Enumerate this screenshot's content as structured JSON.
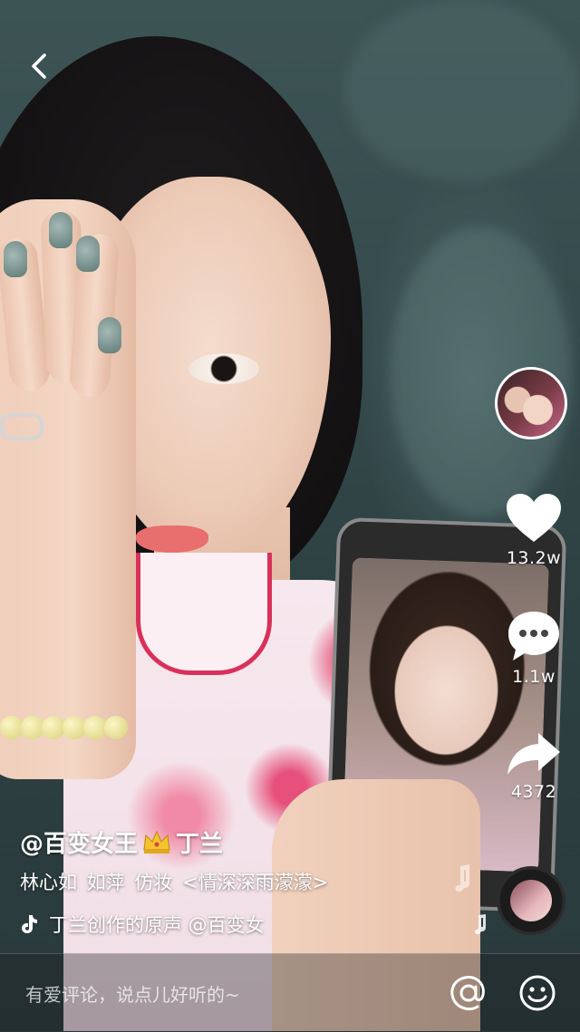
{
  "video": {
    "author_handle": "@百变女王",
    "author_handle_suffix": "丁兰",
    "description": "林心如 如萍 仿妆 <情深深雨濛濛>",
    "music_text": "丁兰创作的原声    @百变女"
  },
  "actions": {
    "likes": "13.2w",
    "comments": "1.1w",
    "shares": "4372"
  },
  "comment_bar": {
    "placeholder": "有爱评论，说点儿好听的~"
  },
  "icons": {
    "back": "chevron-left-icon",
    "like": "heart-icon",
    "comment": "speech-bubble-icon",
    "share": "share-arrow-icon",
    "crown": "crown-icon",
    "music": "tiktok-note-icon",
    "mention": "at-sign-icon",
    "emoji": "smiley-icon"
  },
  "colors": {
    "overlay_text": "#ffffff",
    "crown": "#f4c430"
  }
}
